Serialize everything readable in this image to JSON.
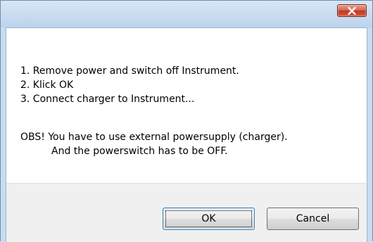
{
  "dialog": {
    "close_label": "",
    "message_lines": [
      "1. Remove power and switch off Instrument.",
      "2. Klick OK",
      "3. Connect charger to Instrument...",
      "OBS! You have to use external powersupply (charger).",
      "And the powerswitch has to be OFF."
    ],
    "ok_label": "OK",
    "cancel_label": "Cancel"
  },
  "colors": {
    "titlebar": "#c9dcf1",
    "close_button": "#c7432a",
    "content_background": "#ffffff",
    "button_area_background": "#f0f0f0",
    "ok_border": "#3c7fb1"
  }
}
